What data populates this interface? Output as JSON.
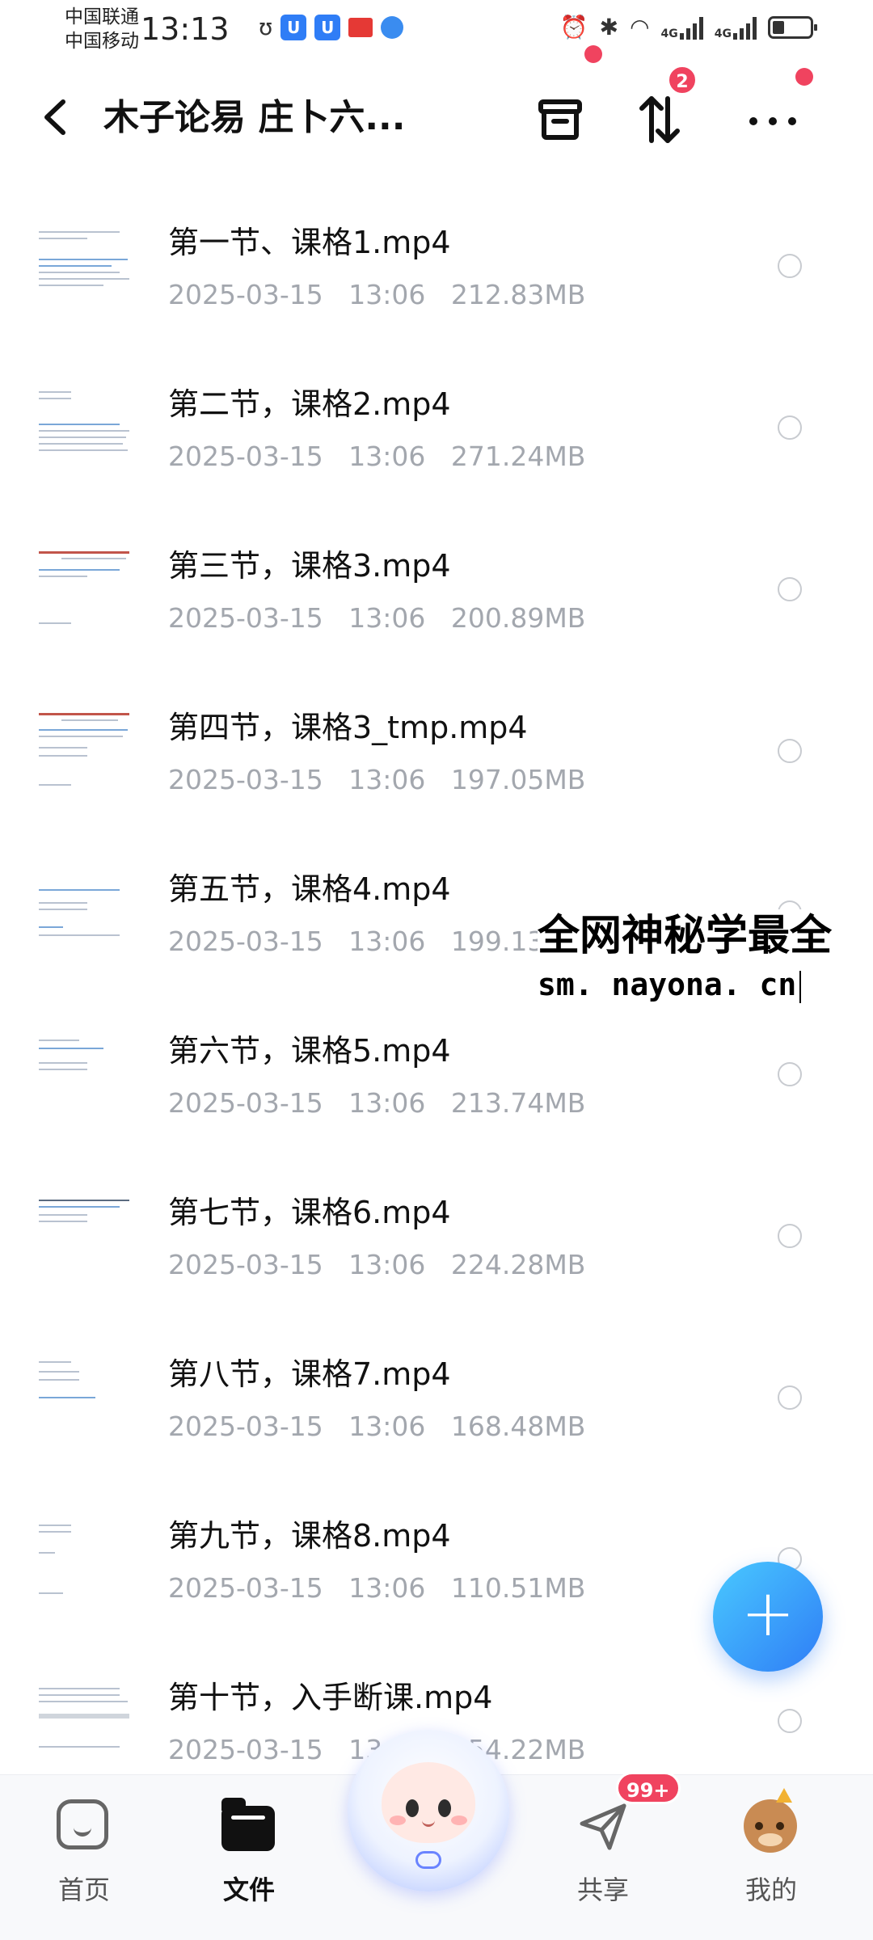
{
  "status_bar": {
    "carrier1": "中国联通",
    "carrier2": "中国移动",
    "time": "13:13",
    "net1": "4G",
    "net2": "4G"
  },
  "header": {
    "title": "木子论易 庄卜六...",
    "sort_badge": "2"
  },
  "files": [
    {
      "name": "第一节、课格1.mp4",
      "date": "2025-03-15",
      "time": "13:06",
      "size": "212.83MB"
    },
    {
      "name": "第二节，课格2.mp4",
      "date": "2025-03-15",
      "time": "13:06",
      "size": "271.24MB"
    },
    {
      "name": "第三节，课格3.mp4",
      "date": "2025-03-15",
      "time": "13:06",
      "size": "200.89MB"
    },
    {
      "name": "第四节，课格3_tmp.mp4",
      "date": "2025-03-15",
      "time": "13:06",
      "size": "197.05MB"
    },
    {
      "name": "第五节，课格4.mp4",
      "date": "2025-03-15",
      "time": "13:06",
      "size": "199.13MB"
    },
    {
      "name": "第六节，课格5.mp4",
      "date": "2025-03-15",
      "time": "13:06",
      "size": "213.74MB"
    },
    {
      "name": "第七节，课格6.mp4",
      "date": "2025-03-15",
      "time": "13:06",
      "size": "224.28MB"
    },
    {
      "name": "第八节，课格7.mp4",
      "date": "2025-03-15",
      "time": "13:06",
      "size": "168.48MB"
    },
    {
      "name": "第九节，课格8.mp4",
      "date": "2025-03-15",
      "time": "13:06",
      "size": "110.51MB"
    },
    {
      "name": "第十节，入手断课.mp4",
      "date": "2025-03-15",
      "time": "13:06",
      "size": "154.22MB"
    }
  ],
  "watermark": {
    "line1": "全网神秘学最全",
    "line2": "sm. nayona. cn"
  },
  "fab": {
    "label": "+"
  },
  "bottom_nav": {
    "items": [
      {
        "label": "首页",
        "icon": "home-icon"
      },
      {
        "label": "文件",
        "icon": "folder-icon"
      },
      {
        "label": "",
        "icon": "mascot-icon"
      },
      {
        "label": "共享",
        "icon": "send-icon"
      },
      {
        "label": "我的",
        "icon": "avatar-icon"
      }
    ],
    "share_badge": "99+"
  },
  "colors": {
    "accent": "#2f7df6",
    "badge": "#f0435f",
    "meta_text": "#a3a7ae"
  }
}
